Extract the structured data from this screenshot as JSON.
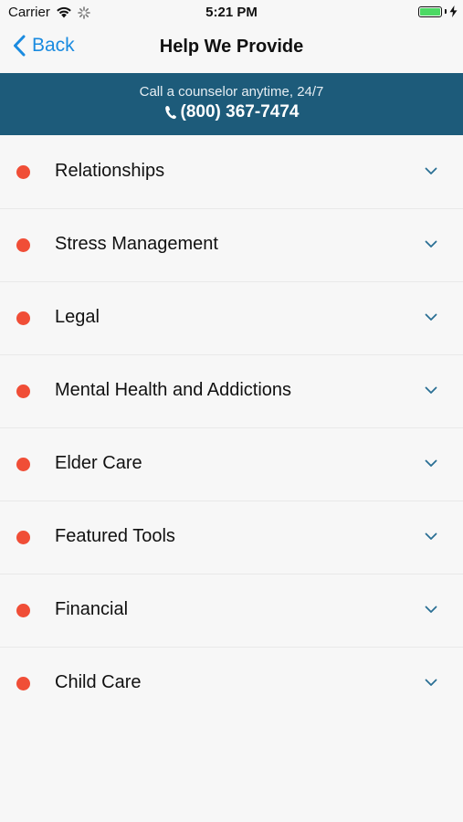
{
  "status_bar": {
    "carrier": "Carrier",
    "time": "5:21 PM"
  },
  "nav": {
    "back_label": "Back",
    "title": "Help We Provide"
  },
  "banner": {
    "text": "Call a counselor anytime, 24/7",
    "phone": "(800) 367-7474"
  },
  "list": {
    "items": [
      {
        "label": "Relationships",
        "icon": "chevron-down-icon"
      },
      {
        "label": "Stress Management",
        "icon": "chevron-down-icon"
      },
      {
        "label": "Legal",
        "icon": "chevron-down-icon"
      },
      {
        "label": "Mental Health and Addictions",
        "icon": "chevron-down-icon"
      },
      {
        "label": "Elder Care",
        "icon": "chevron-down-icon"
      },
      {
        "label": "Featured Tools",
        "icon": "chevron-down-icon"
      },
      {
        "label": "Financial",
        "icon": "chevron-down-icon"
      },
      {
        "label": "Child Care",
        "icon": "chevron-down-icon"
      }
    ]
  },
  "colors": {
    "accent": "#1a8be0",
    "banner": "#1d5b7a",
    "bullet": "#f04e37",
    "battery": "#4cd964"
  }
}
